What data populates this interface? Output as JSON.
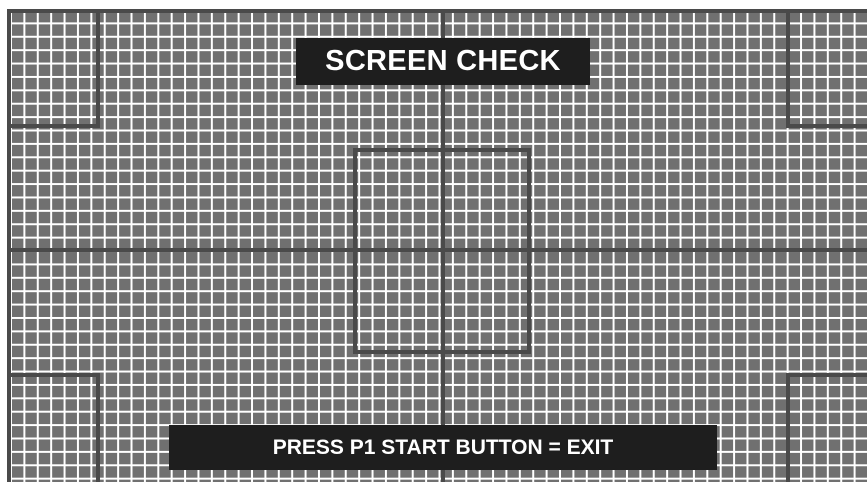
{
  "screen": {
    "title": "SCREEN CHECK",
    "instruction": "PRESS P1 START BUTTON = EXIT"
  },
  "colors": {
    "grid_cell": "#707070",
    "grid_line": "#ffffff",
    "frame_line": "#4a4a4a",
    "label_background": "#1e1e1e",
    "label_text": "#ffffff"
  }
}
